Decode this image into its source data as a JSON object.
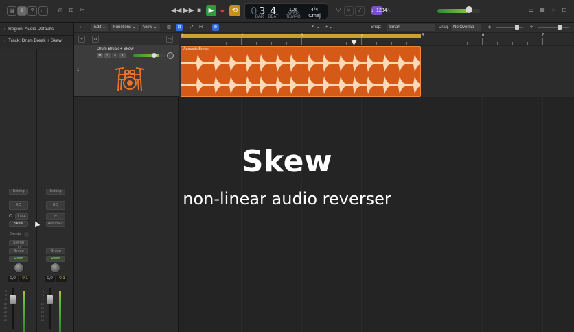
{
  "transport": {
    "position_bar": "3",
    "position_beat": "4",
    "tempo": "106",
    "tempo_label": "KEEP",
    "time_signature": "4/4",
    "key": "Cmaj",
    "lcd_labels": [
      "BAR",
      "BEAT",
      "TEMPO"
    ],
    "count_in": "♩1234"
  },
  "inspector": {
    "region_label": "Region: Audio Defaults",
    "track_label": "Track: Drum Break + Skew",
    "strip1": {
      "setting": "Setting",
      "eq": "EQ",
      "input": "Input",
      "plugin": "Skew",
      "sends": "Sends",
      "output": "Stereo Out",
      "group": "Group",
      "automation": "Read",
      "volume": "0,0",
      "peak": "-0,1"
    },
    "strip2": {
      "setting": "Setting",
      "eq": "EQ",
      "link": "∞",
      "plugin": "Audio FX",
      "group": "Group",
      "automation": "Read",
      "volume": "0,0",
      "peak": "-0,1"
    },
    "fader_scale": [
      "0",
      "3",
      "6",
      "10",
      "15",
      "20",
      "30",
      "40"
    ]
  },
  "toolbar": {
    "edit": "Edit",
    "functions": "Functions",
    "view": "View",
    "snap_label": "Snap:",
    "snap_value": "Smart",
    "drag_label": "Drag:",
    "drag_value": "No Overlap"
  },
  "track": {
    "number": "1",
    "name": "Drum Break + Skew",
    "mute": "M",
    "solo": "S",
    "record": "R",
    "input_monitor": "I",
    "icon": "drum-kit-icon"
  },
  "ruler": {
    "bars": [
      "1",
      "2",
      "3",
      "4",
      "5",
      "6",
      "7"
    ]
  },
  "region": {
    "name": "Acoustic Break",
    "color": "#d55a17"
  },
  "overlay": {
    "title": "Skew",
    "subtitle": "non-linear audio reverser"
  },
  "colors": {
    "play": "#2f9b3b",
    "record": "#e0342f",
    "cycle": "#c88f1d",
    "region": "#d55a17",
    "accent_blue": "#2d6fd6"
  }
}
